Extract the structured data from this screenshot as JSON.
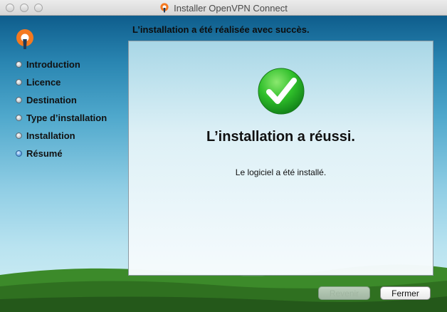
{
  "window": {
    "title": "Installer OpenVPN Connect"
  },
  "header": {
    "text": "L’installation a été réalisée avec succès."
  },
  "sidebar": {
    "steps": [
      {
        "label": "Introduction",
        "active": false
      },
      {
        "label": "Licence",
        "active": false
      },
      {
        "label": "Destination",
        "active": false
      },
      {
        "label": "Type d’installation",
        "active": false
      },
      {
        "label": "Installation",
        "active": false
      },
      {
        "label": "Résumé",
        "active": true
      }
    ]
  },
  "content": {
    "title": "L’installation a réussi.",
    "message": "Le logiciel a été installé."
  },
  "buttons": {
    "back_label": "Revenir",
    "close_label": "Fermer"
  },
  "colors": {
    "brand": "#f47920",
    "success_green": "#2fbf2a",
    "active_step": "#4a8fdc"
  },
  "icons": {
    "logo": "openvpn-logo-icon",
    "success": "checkmark-icon"
  }
}
